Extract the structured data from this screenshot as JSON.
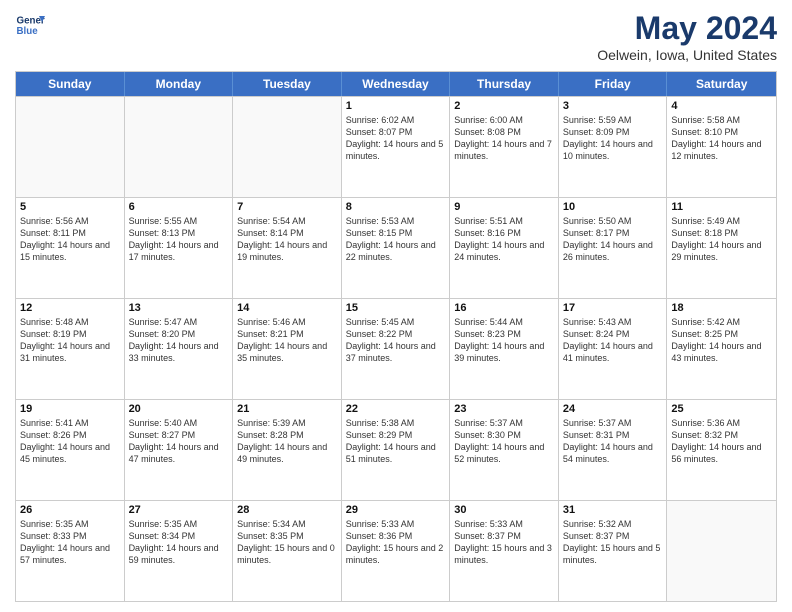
{
  "header": {
    "logo_line1": "General",
    "logo_line2": "Blue",
    "title": "May 2024",
    "subtitle": "Oelwein, Iowa, United States"
  },
  "weekdays": [
    "Sunday",
    "Monday",
    "Tuesday",
    "Wednesday",
    "Thursday",
    "Friday",
    "Saturday"
  ],
  "weeks": [
    [
      {
        "day": "",
        "empty": true
      },
      {
        "day": "",
        "empty": true
      },
      {
        "day": "",
        "empty": true
      },
      {
        "day": "1",
        "sunrise": "Sunrise: 6:02 AM",
        "sunset": "Sunset: 8:07 PM",
        "daylight": "Daylight: 14 hours and 5 minutes."
      },
      {
        "day": "2",
        "sunrise": "Sunrise: 6:00 AM",
        "sunset": "Sunset: 8:08 PM",
        "daylight": "Daylight: 14 hours and 7 minutes."
      },
      {
        "day": "3",
        "sunrise": "Sunrise: 5:59 AM",
        "sunset": "Sunset: 8:09 PM",
        "daylight": "Daylight: 14 hours and 10 minutes."
      },
      {
        "day": "4",
        "sunrise": "Sunrise: 5:58 AM",
        "sunset": "Sunset: 8:10 PM",
        "daylight": "Daylight: 14 hours and 12 minutes."
      }
    ],
    [
      {
        "day": "5",
        "sunrise": "Sunrise: 5:56 AM",
        "sunset": "Sunset: 8:11 PM",
        "daylight": "Daylight: 14 hours and 15 minutes."
      },
      {
        "day": "6",
        "sunrise": "Sunrise: 5:55 AM",
        "sunset": "Sunset: 8:13 PM",
        "daylight": "Daylight: 14 hours and 17 minutes."
      },
      {
        "day": "7",
        "sunrise": "Sunrise: 5:54 AM",
        "sunset": "Sunset: 8:14 PM",
        "daylight": "Daylight: 14 hours and 19 minutes."
      },
      {
        "day": "8",
        "sunrise": "Sunrise: 5:53 AM",
        "sunset": "Sunset: 8:15 PM",
        "daylight": "Daylight: 14 hours and 22 minutes."
      },
      {
        "day": "9",
        "sunrise": "Sunrise: 5:51 AM",
        "sunset": "Sunset: 8:16 PM",
        "daylight": "Daylight: 14 hours and 24 minutes."
      },
      {
        "day": "10",
        "sunrise": "Sunrise: 5:50 AM",
        "sunset": "Sunset: 8:17 PM",
        "daylight": "Daylight: 14 hours and 26 minutes."
      },
      {
        "day": "11",
        "sunrise": "Sunrise: 5:49 AM",
        "sunset": "Sunset: 8:18 PM",
        "daylight": "Daylight: 14 hours and 29 minutes."
      }
    ],
    [
      {
        "day": "12",
        "sunrise": "Sunrise: 5:48 AM",
        "sunset": "Sunset: 8:19 PM",
        "daylight": "Daylight: 14 hours and 31 minutes."
      },
      {
        "day": "13",
        "sunrise": "Sunrise: 5:47 AM",
        "sunset": "Sunset: 8:20 PM",
        "daylight": "Daylight: 14 hours and 33 minutes."
      },
      {
        "day": "14",
        "sunrise": "Sunrise: 5:46 AM",
        "sunset": "Sunset: 8:21 PM",
        "daylight": "Daylight: 14 hours and 35 minutes."
      },
      {
        "day": "15",
        "sunrise": "Sunrise: 5:45 AM",
        "sunset": "Sunset: 8:22 PM",
        "daylight": "Daylight: 14 hours and 37 minutes."
      },
      {
        "day": "16",
        "sunrise": "Sunrise: 5:44 AM",
        "sunset": "Sunset: 8:23 PM",
        "daylight": "Daylight: 14 hours and 39 minutes."
      },
      {
        "day": "17",
        "sunrise": "Sunrise: 5:43 AM",
        "sunset": "Sunset: 8:24 PM",
        "daylight": "Daylight: 14 hours and 41 minutes."
      },
      {
        "day": "18",
        "sunrise": "Sunrise: 5:42 AM",
        "sunset": "Sunset: 8:25 PM",
        "daylight": "Daylight: 14 hours and 43 minutes."
      }
    ],
    [
      {
        "day": "19",
        "sunrise": "Sunrise: 5:41 AM",
        "sunset": "Sunset: 8:26 PM",
        "daylight": "Daylight: 14 hours and 45 minutes."
      },
      {
        "day": "20",
        "sunrise": "Sunrise: 5:40 AM",
        "sunset": "Sunset: 8:27 PM",
        "daylight": "Daylight: 14 hours and 47 minutes."
      },
      {
        "day": "21",
        "sunrise": "Sunrise: 5:39 AM",
        "sunset": "Sunset: 8:28 PM",
        "daylight": "Daylight: 14 hours and 49 minutes."
      },
      {
        "day": "22",
        "sunrise": "Sunrise: 5:38 AM",
        "sunset": "Sunset: 8:29 PM",
        "daylight": "Daylight: 14 hours and 51 minutes."
      },
      {
        "day": "23",
        "sunrise": "Sunrise: 5:37 AM",
        "sunset": "Sunset: 8:30 PM",
        "daylight": "Daylight: 14 hours and 52 minutes."
      },
      {
        "day": "24",
        "sunrise": "Sunrise: 5:37 AM",
        "sunset": "Sunset: 8:31 PM",
        "daylight": "Daylight: 14 hours and 54 minutes."
      },
      {
        "day": "25",
        "sunrise": "Sunrise: 5:36 AM",
        "sunset": "Sunset: 8:32 PM",
        "daylight": "Daylight: 14 hours and 56 minutes."
      }
    ],
    [
      {
        "day": "26",
        "sunrise": "Sunrise: 5:35 AM",
        "sunset": "Sunset: 8:33 PM",
        "daylight": "Daylight: 14 hours and 57 minutes."
      },
      {
        "day": "27",
        "sunrise": "Sunrise: 5:35 AM",
        "sunset": "Sunset: 8:34 PM",
        "daylight": "Daylight: 14 hours and 59 minutes."
      },
      {
        "day": "28",
        "sunrise": "Sunrise: 5:34 AM",
        "sunset": "Sunset: 8:35 PM",
        "daylight": "Daylight: 15 hours and 0 minutes."
      },
      {
        "day": "29",
        "sunrise": "Sunrise: 5:33 AM",
        "sunset": "Sunset: 8:36 PM",
        "daylight": "Daylight: 15 hours and 2 minutes."
      },
      {
        "day": "30",
        "sunrise": "Sunrise: 5:33 AM",
        "sunset": "Sunset: 8:37 PM",
        "daylight": "Daylight: 15 hours and 3 minutes."
      },
      {
        "day": "31",
        "sunrise": "Sunrise: 5:32 AM",
        "sunset": "Sunset: 8:37 PM",
        "daylight": "Daylight: 15 hours and 5 minutes."
      },
      {
        "day": "",
        "empty": true
      }
    ]
  ]
}
